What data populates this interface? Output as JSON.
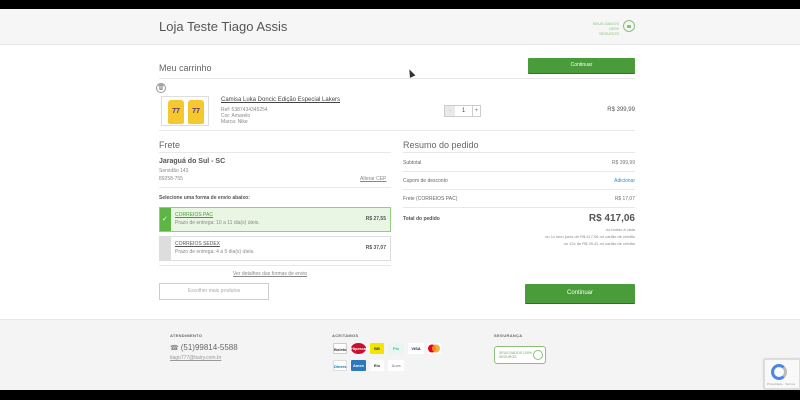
{
  "header": {
    "store_title": "Loja Teste Tiago Assis",
    "secure_text": "SEUS DADOS 100% SEGUROS"
  },
  "cart": {
    "title": "Meu carrinho",
    "continue_top": "Continuar",
    "item": {
      "name": "Camisa Luka Doncic Edição Especial Lakers",
      "ref": "Ref: 5387434345254",
      "color": "Cor: Amarelo",
      "brand": "Marca: Nike",
      "quantity": "1",
      "minus": "-",
      "plus": "+",
      "price": "R$ 399,99",
      "jersey_number": "77"
    }
  },
  "shipping": {
    "title": "Frete",
    "city": "Jaraguá do Sul - SC",
    "address": "Servidão 143",
    "cep": "89258-755",
    "change_cep": "Alterar CEP",
    "choose_label": "Selecione uma forma de envio abaixo:",
    "options": [
      {
        "name": "CORREIOS PAC",
        "deadline": "Prazo de entrega: 10 a 11 dia(s) úteis.",
        "price": "R$ 27,55",
        "selected": true
      },
      {
        "name": "CORREIOS SEDEX",
        "deadline": "Prazo de entrega: 4 a 5 dia(s) úteis.",
        "price": "R$ 37,07",
        "selected": false
      }
    ],
    "details_link": "Ver detalhes das formas de envio",
    "choose_more": "Escolher mais produtos"
  },
  "summary": {
    "title": "Resumo do pedido",
    "subtotal_label": "Subtotal",
    "subtotal_value": "R$ 399,99",
    "coupon_label": "Cupom de desconto",
    "coupon_action": "Adicionar",
    "shipping_label": "Frete (CORREIOS PAC)",
    "shipping_value": "R$ 17,07",
    "total_label": "Total do pedido",
    "total_value": "R$ 417,06",
    "note_boleto": "no boleto à vista",
    "note_card1": "ou 1x sem juros de R$ 417,06 no cartão de crédito",
    "note_card12": "ou 12x de R$ 39,41 no cartão de crédito",
    "continue": "Continuar"
  },
  "footer": {
    "service_title": "ATENDIMENTO",
    "phone": "(51)99814-5588",
    "email": "tiago777@bairy.com.br",
    "accept_title": "ACEITAMOS",
    "security_title": "SEGURANÇA",
    "payments": [
      "Boleto",
      "Hipercard",
      "BB",
      "Pix",
      "VISA",
      "Mastercard",
      "Diners",
      "Amex",
      "Elo",
      "Aura"
    ]
  },
  "recaptcha": {
    "text": "Privacidade - Termos"
  },
  "colors": {
    "accent": "#4a9c3a",
    "link": "#2d8fc8",
    "secure": "#8dbf7a"
  }
}
